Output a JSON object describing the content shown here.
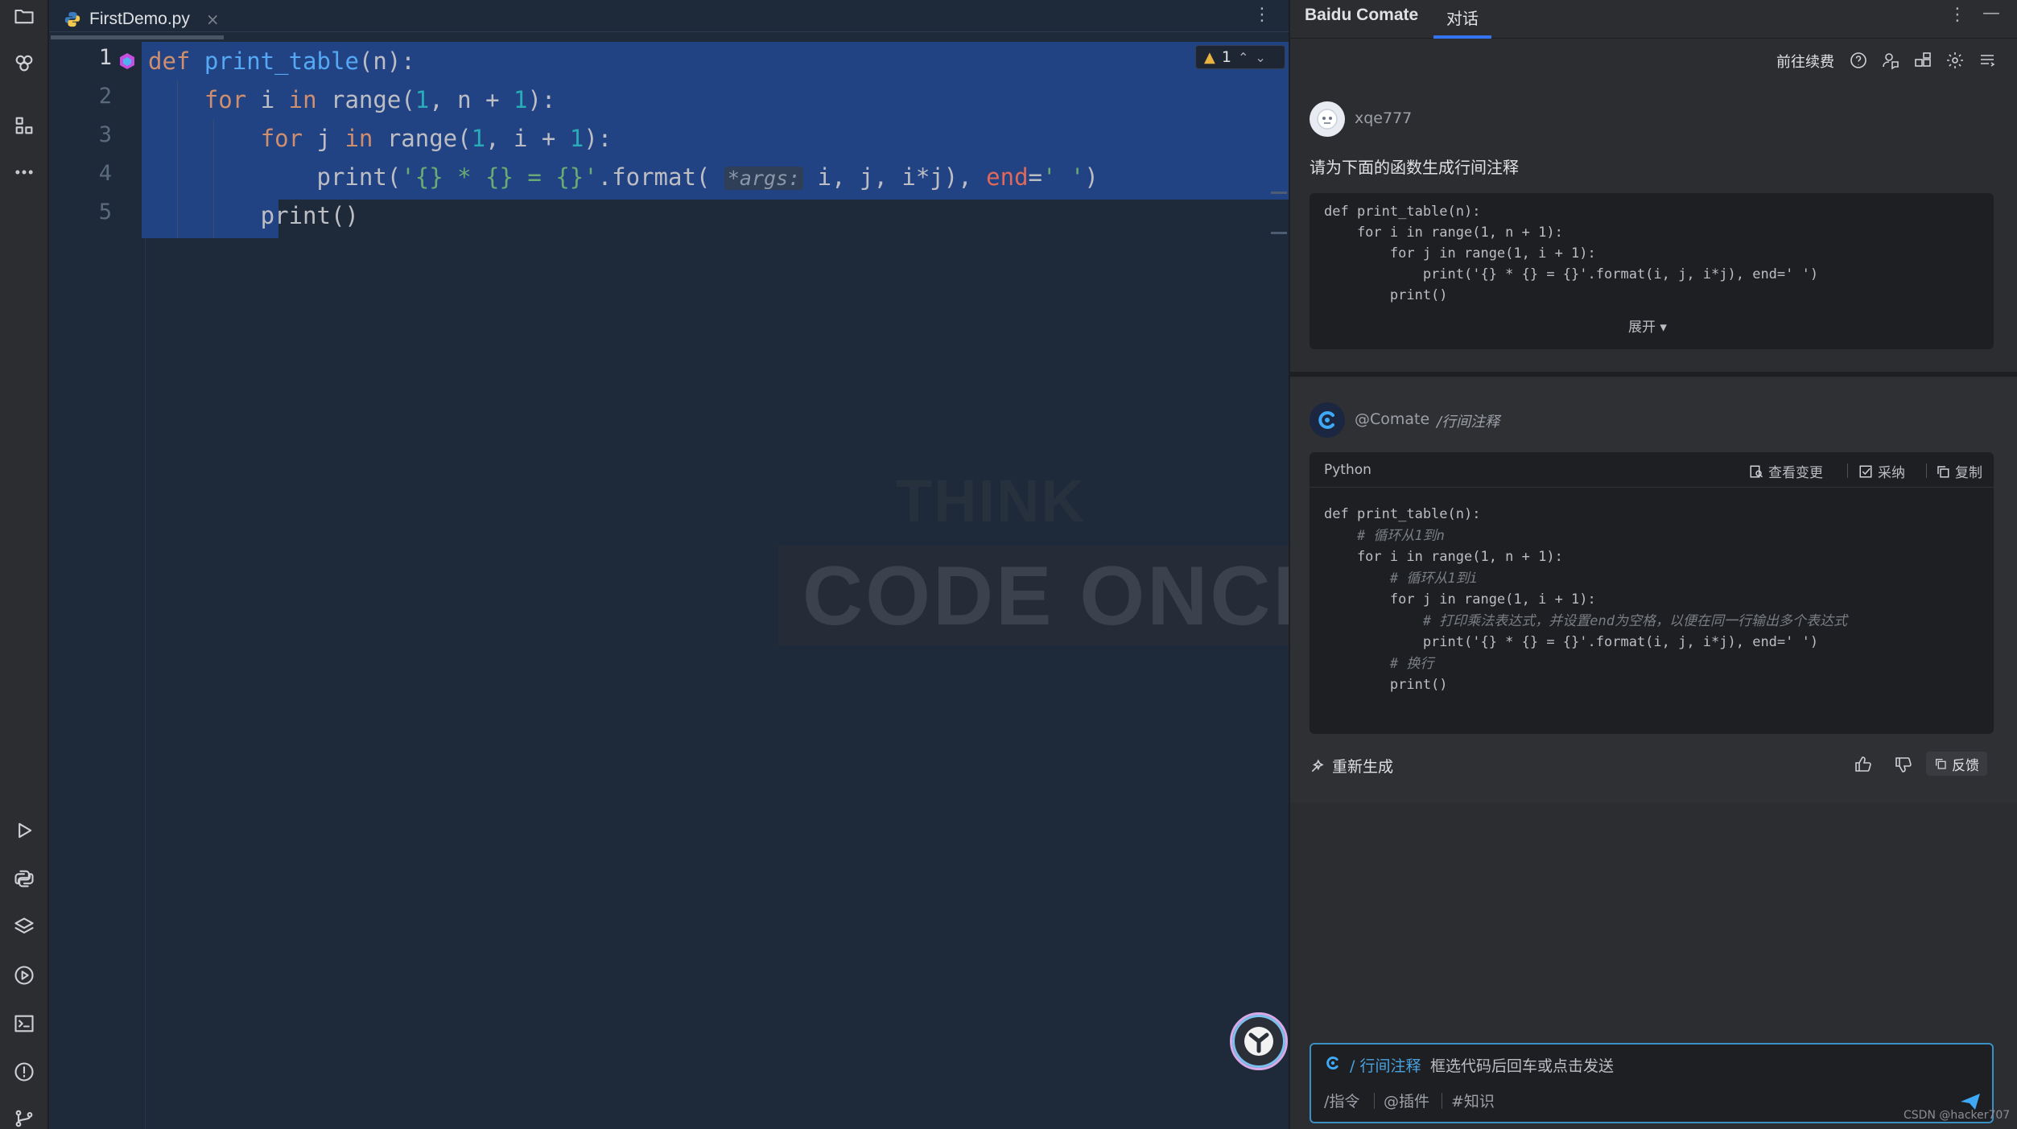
{
  "editor": {
    "tab": {
      "file_name": "FirstDemo.py",
      "close": "×"
    },
    "more_menu": "⋮",
    "inspections": {
      "warnings": "1"
    },
    "line_numbers": [
      "1",
      "2",
      "3",
      "4",
      "5"
    ],
    "code": [
      {
        "tokens": [
          [
            "kw",
            "def "
          ],
          [
            "fn",
            "print_table"
          ],
          [
            "",
            "(n):"
          ]
        ]
      },
      {
        "tokens": [
          [
            "",
            "    "
          ],
          [
            "kw",
            "for "
          ],
          [
            "",
            "i "
          ],
          [
            "kw",
            "in "
          ],
          [
            "",
            "range("
          ],
          [
            "num",
            "1"
          ],
          [
            "",
            ", n + "
          ],
          [
            "num",
            "1"
          ],
          [
            "",
            "):"
          ]
        ]
      },
      {
        "tokens": [
          [
            "",
            "        "
          ],
          [
            "kw",
            "for "
          ],
          [
            "",
            "j "
          ],
          [
            "kw",
            "in "
          ],
          [
            "",
            "range("
          ],
          [
            "num",
            "1"
          ],
          [
            "",
            ", i + "
          ],
          [
            "num",
            "1"
          ],
          [
            "",
            "):"
          ]
        ]
      },
      {
        "tokens": [
          [
            "",
            "            print("
          ],
          [
            "str",
            "'{} * {} = {}'"
          ],
          [
            "",
            ".format( "
          ],
          [
            "hint",
            "*args:"
          ],
          [
            "",
            " i, j, i*j), "
          ],
          [
            "named",
            "end"
          ],
          [
            "",
            "="
          ],
          [
            "str",
            "' '"
          ],
          [
            "",
            ")"
          ]
        ]
      },
      {
        "tokens": [
          [
            "",
            "        print()"
          ]
        ]
      }
    ],
    "watermark": {
      "line1": "THINK TWICE",
      "line2": "CODE ONCE!"
    }
  },
  "panel": {
    "title": "Baidu Comate",
    "tab_chat": "对话",
    "renew_label": "前往续费",
    "user": {
      "name": "xqe777",
      "message": "请为下面的函数生成行间注释",
      "code": [
        "def print_table(n):",
        "    for i in range(1, n + 1):",
        "        for j in range(1, i + 1):",
        "            print('{} * {} = {}'.format(i, j, i*j), end=' ')",
        "        print()"
      ],
      "expand_label": "展开 ▾"
    },
    "bot": {
      "name": "@Comate",
      "command": "/行间注释",
      "language": "Python",
      "actions": {
        "view_changes": "查看变更",
        "adopt": "采纳",
        "copy": "复制"
      },
      "code": [
        {
          "text": "def print_table(n):",
          "comment": false
        },
        {
          "text": "    # 循环从1到n",
          "comment": true
        },
        {
          "text": "    for i in range(1, n + 1):",
          "comment": false
        },
        {
          "text": "        # 循环从1到i",
          "comment": true
        },
        {
          "text": "        for j in range(1, i + 1):",
          "comment": false
        },
        {
          "text": "            # 打印乘法表达式，并设置end为空格，以便在同一行输出多个表达式",
          "comment": true
        },
        {
          "text": "            print('{} * {} = {}'.format(i, j, i*j), end=' ')",
          "comment": false
        },
        {
          "text": "        # 换行",
          "comment": true
        },
        {
          "text": "        print()",
          "comment": false
        }
      ],
      "regenerate": "重新生成",
      "feedback": "反馈"
    },
    "input": {
      "command": "/ 行间注释",
      "placeholder": "框选代码后回车或点击发送",
      "chips": [
        "/指令",
        "@插件",
        "#知识"
      ]
    },
    "footer_watermark": "CSDN @hacker707"
  }
}
